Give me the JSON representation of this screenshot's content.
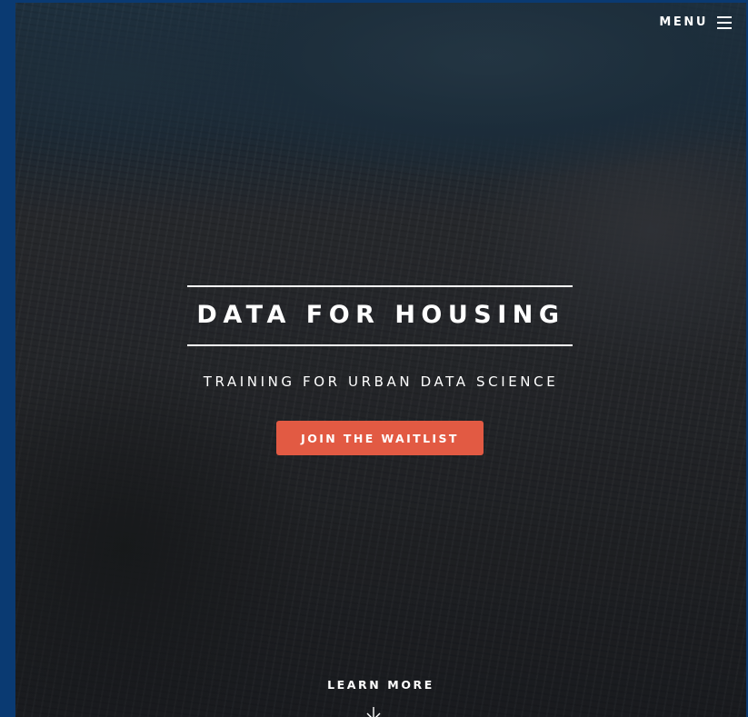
{
  "nav": {
    "menu_label": "MENU",
    "menu_icon": "hamburger-icon"
  },
  "hero": {
    "title": "DATA FOR HOUSING",
    "subtitle": "TRAINING FOR URBAN DATA SCIENCE",
    "cta_label": "JOIN THE WAITLIST",
    "learn_more_label": "LEARN MORE",
    "scroll_icon": "arrow-down-icon"
  },
  "colors": {
    "frame": "#0a3a72",
    "cta_background": "#e25a43",
    "text": "#ffffff"
  }
}
